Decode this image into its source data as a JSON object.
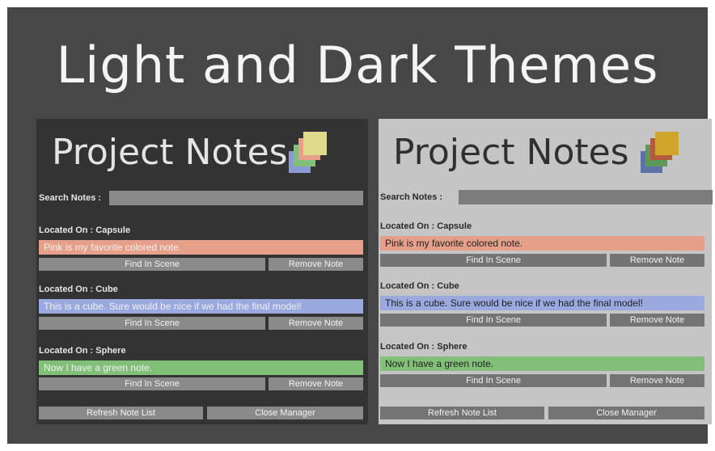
{
  "heading": "Light and Dark Themes",
  "colors": {
    "outer_bg": "#474747",
    "dark_panel_bg": "#333333",
    "light_panel_bg": "#c5c5c5",
    "note_pink": "#e6a08a",
    "note_blue": "#9aa9e0",
    "note_green": "#82c07a",
    "button_bg": "#8a8a8a",
    "icon_dark_squares": [
      "#8c9ad3",
      "#82c07a",
      "#e6a08a",
      "#dedc8c"
    ],
    "icon_light_squares": [
      "#5d73a8",
      "#5e9957",
      "#b55b3d",
      "#cfa52a"
    ]
  },
  "panels": {
    "dark": {
      "title": "Project Notes",
      "icon": "sticky-notes-icon",
      "search_label": "Search Notes :",
      "search_value": "",
      "notes": [
        {
          "location": "Located On : Capsule",
          "text": "Pink is my favorite colored note.",
          "color": "pink"
        },
        {
          "location": "Located On : Cube",
          "text": "This is a cube. Sure would be nice if we had the final model!",
          "color": "blue"
        },
        {
          "location": "Located On : Sphere",
          "text": "Now I have a green note.",
          "color": "green"
        }
      ],
      "find_label": "Find In Scene",
      "remove_label": "Remove Note",
      "refresh_label": "Refresh Note List",
      "close_label": "Close Manager"
    },
    "light": {
      "title": "Project Notes",
      "icon": "sticky-notes-icon",
      "search_label": "Search Notes :",
      "search_value": "",
      "notes": [
        {
          "location": "Located On : Capsule",
          "text": "Pink is my favorite colored note.",
          "color": "pink"
        },
        {
          "location": "Located On : Cube",
          "text": "This is a cube. Sure would be nice if we had the final model!",
          "color": "blue"
        },
        {
          "location": "Located On : Sphere",
          "text": "Now I have a green note.",
          "color": "green"
        }
      ],
      "find_label": "Find In Scene",
      "remove_label": "Remove Note",
      "refresh_label": "Refresh Note List",
      "close_label": "Close Manager"
    }
  }
}
